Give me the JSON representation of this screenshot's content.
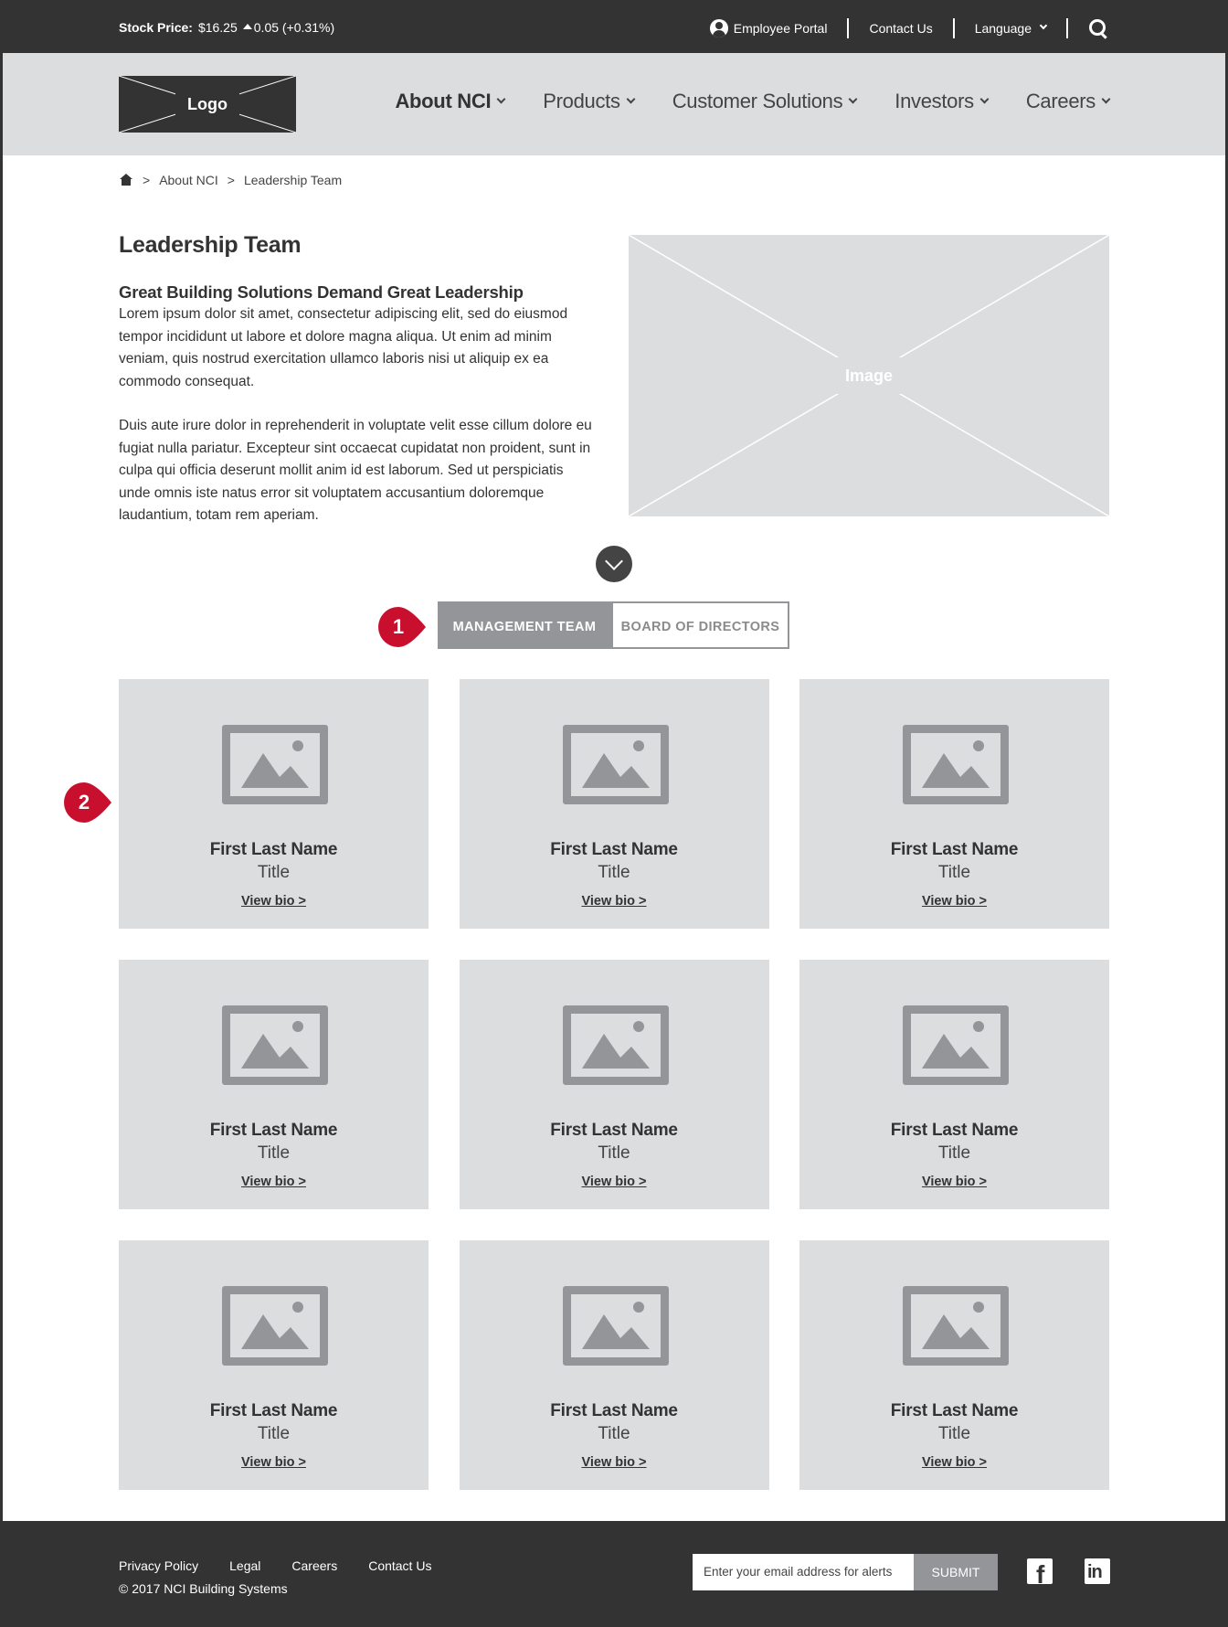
{
  "topbar": {
    "stock_label": "Stock Price:",
    "stock_value": "$16.25",
    "stock_change": "0.05 (+0.31%)",
    "employee_portal": "Employee Portal",
    "contact_us": "Contact Us",
    "language": "Language"
  },
  "header": {
    "logo_text": "Logo",
    "nav": [
      {
        "label": "About NCI",
        "active": true
      },
      {
        "label": "Products"
      },
      {
        "label": "Customer Solutions"
      },
      {
        "label": "Investors"
      },
      {
        "label": "Careers"
      }
    ]
  },
  "breadcrumb": {
    "items": [
      "About NCI",
      "Leadership Team"
    ],
    "separator": ">"
  },
  "intro": {
    "page_title": "Leadership Team",
    "heading": "Great Building Solutions Demand Great Leadership",
    "para1": "Lorem ipsum dolor sit amet, consectetur adipiscing elit, sed do eiusmod tempor incididunt ut labore et dolore magna aliqua. Ut enim ad minim veniam, quis nostrud exercitation ullamco laboris nisi ut aliquip ex ea commodo consequat.",
    "para2": "Duis aute irure dolor in reprehenderit in voluptate velit esse cillum dolore eu fugiat nulla pariatur. Excepteur sint occaecat cupidatat non proident, sunt in culpa qui officia deserunt mollit anim id est laborum. Sed ut perspiciatis unde omnis iste natus error sit voluptatem accusantium doloremque laudantium, totam rem aperiam.",
    "image_label": "Image"
  },
  "tabs": {
    "management": "MANAGEMENT TEAM",
    "board": "BOARD OF DIRECTORS",
    "active": "management"
  },
  "markers": [
    "1",
    "2"
  ],
  "team": [
    {
      "name": "First Last Name",
      "title": "Title",
      "bio": "View bio >"
    },
    {
      "name": "First Last Name",
      "title": "Title",
      "bio": "View bio >"
    },
    {
      "name": "First Last Name",
      "title": "Title",
      "bio": "View bio >"
    },
    {
      "name": "First Last Name",
      "title": "Title",
      "bio": "View bio >"
    },
    {
      "name": "First Last Name",
      "title": "Title",
      "bio": "View bio >"
    },
    {
      "name": "First Last Name",
      "title": "Title",
      "bio": "View bio >"
    },
    {
      "name": "First Last Name",
      "title": "Title",
      "bio": "View bio >"
    },
    {
      "name": "First Last Name",
      "title": "Title",
      "bio": "View bio >"
    },
    {
      "name": "First Last Name",
      "title": "Title",
      "bio": "View bio >"
    }
  ],
  "footer": {
    "links": [
      "Privacy Policy",
      "Legal",
      "Careers",
      "Contact Us"
    ],
    "copyright": "© 2017 NCI Building Systems",
    "email_placeholder": "Enter your email address for alerts",
    "submit": "SUBMIT",
    "facebook_glyph": "f",
    "linkedin_glyph": "in"
  },
  "colors": {
    "dark": "#333333",
    "light_gray": "#dcdddf",
    "mid_gray": "#939598",
    "marker_red": "#c8102e"
  }
}
